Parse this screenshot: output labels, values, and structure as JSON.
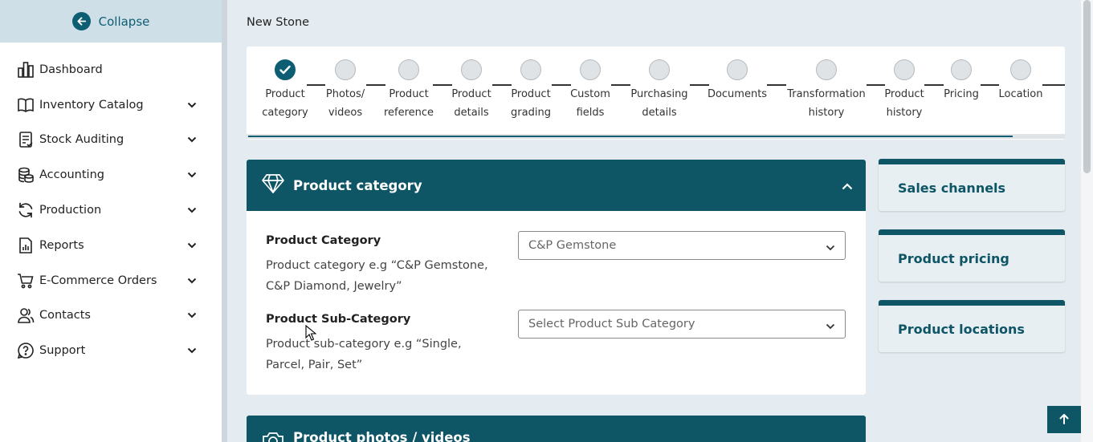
{
  "sidebar": {
    "collapse_label": "Collapse",
    "items": [
      {
        "label": "Dashboard",
        "icon": "dashboard-icon",
        "expandable": false
      },
      {
        "label": "Inventory Catalog",
        "icon": "book-icon",
        "expandable": true
      },
      {
        "label": "Stock Auditing",
        "icon": "clipboard-icon",
        "expandable": true
      },
      {
        "label": "Accounting",
        "icon": "coins-icon",
        "expandable": true
      },
      {
        "label": "Production",
        "icon": "refresh-icon",
        "expandable": true
      },
      {
        "label": "Reports",
        "icon": "report-icon",
        "expandable": true
      },
      {
        "label": "E-Commerce Orders",
        "icon": "cart-icon",
        "expandable": true
      },
      {
        "label": "Contacts",
        "icon": "users-icon",
        "expandable": true
      },
      {
        "label": "Support",
        "icon": "help-icon",
        "expandable": true
      }
    ]
  },
  "page": {
    "subtitle": "New Stone"
  },
  "stepper": {
    "steps": [
      {
        "line1": "Product",
        "line2": "category",
        "done": true
      },
      {
        "line1": "Photos/",
        "line2": "videos",
        "done": false
      },
      {
        "line1": "Product",
        "line2": "reference",
        "done": false
      },
      {
        "line1": "Product",
        "line2": "details",
        "done": false
      },
      {
        "line1": "Product",
        "line2": "grading",
        "done": false
      },
      {
        "line1": "Custom",
        "line2": "fields",
        "done": false
      },
      {
        "line1": "Purchasing",
        "line2": "details",
        "done": false
      },
      {
        "line1": "Documents",
        "line2": "",
        "done": false
      },
      {
        "line1": "Transformation",
        "line2": "history",
        "done": false
      },
      {
        "line1": "Product",
        "line2": "history",
        "done": false
      },
      {
        "line1": "Pricing",
        "line2": "",
        "done": false
      },
      {
        "line1": "Location",
        "line2": "",
        "done": false
      }
    ]
  },
  "category_panel": {
    "title": "Product category",
    "category_label": "Product Category",
    "category_help": "Product category e.g “C&P Gemstone, C&P Diamond, Jewelry”",
    "category_value": "C&P Gemstone",
    "subcategory_label": "Product Sub-Category",
    "subcategory_help": "Product sub-category e.g “Single, Parcel, Pair, Set”",
    "subcategory_placeholder": "Select Product Sub Category"
  },
  "photos_panel": {
    "title": "Product photos / videos"
  },
  "side_cards": [
    {
      "title": "Sales channels"
    },
    {
      "title": "Product pricing"
    },
    {
      "title": "Product locations"
    }
  ],
  "colors": {
    "accent": "#0e5566",
    "sidebar_collapse_bg": "#cfdfe8",
    "page_bg": "#e5ecf1"
  }
}
